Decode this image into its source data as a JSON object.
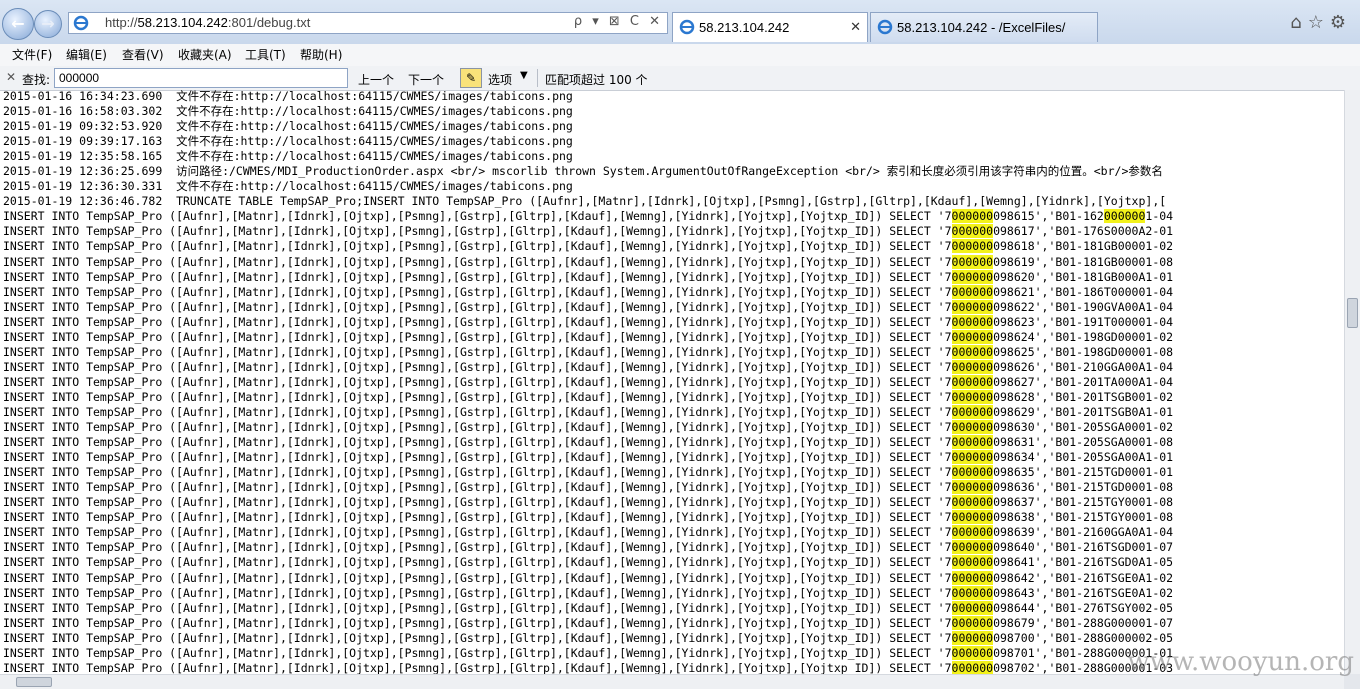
{
  "browser": {
    "address_url_prefix": "http://",
    "address_url_host": "58.213.104.242",
    "address_url_rest": ":801/debug.txt",
    "address_tools": "ρ ▾ ⊠ C ✕",
    "tabs": [
      {
        "title": "58.213.104.242"
      },
      {
        "title": "58.213.104.242 - /ExcelFiles/"
      }
    ],
    "close_label": "✕"
  },
  "menu": [
    "文件(F)",
    "编辑(E)",
    "查看(V)",
    "收藏夹(A)",
    "工具(T)",
    "帮助(H)"
  ],
  "find": {
    "label": "查找:",
    "value": "000000",
    "prev": "上一个",
    "next": "下一个",
    "options": "选项",
    "count": "匹配项超过 100 个"
  },
  "log_lines": [
    "2015-01-16 16:34:23.690  文件不存在:http://localhost:64115/CWMES/images/tabicons.png",
    "2015-01-16 16:58:03.302  文件不存在:http://localhost:64115/CWMES/images/tabicons.png",
    "2015-01-19 09:32:53.920  文件不存在:http://localhost:64115/CWMES/images/tabicons.png",
    "2015-01-19 09:39:17.163  文件不存在:http://localhost:64115/CWMES/images/tabicons.png",
    "2015-01-19 12:35:58.165  文件不存在:http://localhost:64115/CWMES/images/tabicons.png",
    "2015-01-19 12:36:25.699  访问路径:/CWMES/MDI_ProductionOrder.aspx <br/> mscorlib thrown System.ArgumentOutOfRangeException <br/> 索引和长度必须引用该字符串内的位置。<br/>参数名",
    "2015-01-19 12:36:30.331  文件不存在:http://localhost:64115/CWMES/images/tabicons.png",
    "2015-01-19 12:36:46.782  TRUNCATE TABLE TempSAP_Pro;INSERT INTO TempSAP_Pro ([Aufnr],[Matnr],[Idnrk],[Ojtxp],[Psmng],[Gstrp],[Gltrp],[Kdauf],[Wemng],[Yidnrk],[Yojtxp],[",
    "INSERT INTO TempSAP_Pro ([Aufnr],[Matnr],[Idnrk],[Ojtxp],[Psmng],[Gstrp],[Gltrp],[Kdauf],[Wemng],[Yidnrk],[Yojtxp],[Yojtxp_ID]) SELECT '7000000098615','B01-1620000001-04",
    "INSERT INTO TempSAP_Pro ([Aufnr],[Matnr],[Idnrk],[Ojtxp],[Psmng],[Gstrp],[Gltrp],[Kdauf],[Wemng],[Yidnrk],[Yojtxp],[Yojtxp_ID]) SELECT '7000000098617','B01-176S0000A2-01",
    "INSERT INTO TempSAP_Pro ([Aufnr],[Matnr],[Idnrk],[Ojtxp],[Psmng],[Gstrp],[Gltrp],[Kdauf],[Wemng],[Yidnrk],[Yojtxp],[Yojtxp_ID]) SELECT '7000000098618','B01-181GB00001-02",
    "INSERT INTO TempSAP_Pro ([Aufnr],[Matnr],[Idnrk],[Ojtxp],[Psmng],[Gstrp],[Gltrp],[Kdauf],[Wemng],[Yidnrk],[Yojtxp],[Yojtxp_ID]) SELECT '7000000098619','B01-181GB00001-08",
    "INSERT INTO TempSAP_Pro ([Aufnr],[Matnr],[Idnrk],[Ojtxp],[Psmng],[Gstrp],[Gltrp],[Kdauf],[Wemng],[Yidnrk],[Yojtxp],[Yojtxp_ID]) SELECT '7000000098620','B01-181GB000A1-01",
    "INSERT INTO TempSAP_Pro ([Aufnr],[Matnr],[Idnrk],[Ojtxp],[Psmng],[Gstrp],[Gltrp],[Kdauf],[Wemng],[Yidnrk],[Yojtxp],[Yojtxp_ID]) SELECT '7000000098621','B01-186T000001-04",
    "INSERT INTO TempSAP_Pro ([Aufnr],[Matnr],[Idnrk],[Ojtxp],[Psmng],[Gstrp],[Gltrp],[Kdauf],[Wemng],[Yidnrk],[Yojtxp],[Yojtxp_ID]) SELECT '7000000098622','B01-190GVA00A1-04",
    "INSERT INTO TempSAP_Pro ([Aufnr],[Matnr],[Idnrk],[Ojtxp],[Psmng],[Gstrp],[Gltrp],[Kdauf],[Wemng],[Yidnrk],[Yojtxp],[Yojtxp_ID]) SELECT '7000000098623','B01-191T000001-04",
    "INSERT INTO TempSAP_Pro ([Aufnr],[Matnr],[Idnrk],[Ojtxp],[Psmng],[Gstrp],[Gltrp],[Kdauf],[Wemng],[Yidnrk],[Yojtxp],[Yojtxp_ID]) SELECT '7000000098624','B01-198GD00001-02",
    "INSERT INTO TempSAP_Pro ([Aufnr],[Matnr],[Idnrk],[Ojtxp],[Psmng],[Gstrp],[Gltrp],[Kdauf],[Wemng],[Yidnrk],[Yojtxp],[Yojtxp_ID]) SELECT '7000000098625','B01-198GD00001-08",
    "INSERT INTO TempSAP_Pro ([Aufnr],[Matnr],[Idnrk],[Ojtxp],[Psmng],[Gstrp],[Gltrp],[Kdauf],[Wemng],[Yidnrk],[Yojtxp],[Yojtxp_ID]) SELECT '7000000098626','B01-210GGA00A1-04",
    "INSERT INTO TempSAP_Pro ([Aufnr],[Matnr],[Idnrk],[Ojtxp],[Psmng],[Gstrp],[Gltrp],[Kdauf],[Wemng],[Yidnrk],[Yojtxp],[Yojtxp_ID]) SELECT '7000000098627','B01-201TA000A1-04",
    "INSERT INTO TempSAP_Pro ([Aufnr],[Matnr],[Idnrk],[Ojtxp],[Psmng],[Gstrp],[Gltrp],[Kdauf],[Wemng],[Yidnrk],[Yojtxp],[Yojtxp_ID]) SELECT '7000000098628','B01-201TSGB001-02",
    "INSERT INTO TempSAP_Pro ([Aufnr],[Matnr],[Idnrk],[Ojtxp],[Psmng],[Gstrp],[Gltrp],[Kdauf],[Wemng],[Yidnrk],[Yojtxp],[Yojtxp_ID]) SELECT '7000000098629','B01-201TSGB0A1-01",
    "INSERT INTO TempSAP_Pro ([Aufnr],[Matnr],[Idnrk],[Ojtxp],[Psmng],[Gstrp],[Gltrp],[Kdauf],[Wemng],[Yidnrk],[Yojtxp],[Yojtxp_ID]) SELECT '7000000098630','B01-205SGA0001-02",
    "INSERT INTO TempSAP_Pro ([Aufnr],[Matnr],[Idnrk],[Ojtxp],[Psmng],[Gstrp],[Gltrp],[Kdauf],[Wemng],[Yidnrk],[Yojtxp],[Yojtxp_ID]) SELECT '7000000098631','B01-205SGA0001-08",
    "INSERT INTO TempSAP_Pro ([Aufnr],[Matnr],[Idnrk],[Ojtxp],[Psmng],[Gstrp],[Gltrp],[Kdauf],[Wemng],[Yidnrk],[Yojtxp],[Yojtxp_ID]) SELECT '7000000098634','B01-205SGA00A1-01",
    "INSERT INTO TempSAP_Pro ([Aufnr],[Matnr],[Idnrk],[Ojtxp],[Psmng],[Gstrp],[Gltrp],[Kdauf],[Wemng],[Yidnrk],[Yojtxp],[Yojtxp_ID]) SELECT '7000000098635','B01-215TGD0001-01",
    "INSERT INTO TempSAP_Pro ([Aufnr],[Matnr],[Idnrk],[Ojtxp],[Psmng],[Gstrp],[Gltrp],[Kdauf],[Wemng],[Yidnrk],[Yojtxp],[Yojtxp_ID]) SELECT '7000000098636','B01-215TGD0001-08",
    "INSERT INTO TempSAP_Pro ([Aufnr],[Matnr],[Idnrk],[Ojtxp],[Psmng],[Gstrp],[Gltrp],[Kdauf],[Wemng],[Yidnrk],[Yojtxp],[Yojtxp_ID]) SELECT '7000000098637','B01-215TGY0001-08",
    "INSERT INTO TempSAP_Pro ([Aufnr],[Matnr],[Idnrk],[Ojtxp],[Psmng],[Gstrp],[Gltrp],[Kdauf],[Wemng],[Yidnrk],[Yojtxp],[Yojtxp_ID]) SELECT '7000000098638','B01-215TGY0001-08",
    "INSERT INTO TempSAP_Pro ([Aufnr],[Matnr],[Idnrk],[Ojtxp],[Psmng],[Gstrp],[Gltrp],[Kdauf],[Wemng],[Yidnrk],[Yojtxp],[Yojtxp_ID]) SELECT '7000000098639','B01-2160GGA0A1-04",
    "INSERT INTO TempSAP_Pro ([Aufnr],[Matnr],[Idnrk],[Ojtxp],[Psmng],[Gstrp],[Gltrp],[Kdauf],[Wemng],[Yidnrk],[Yojtxp],[Yojtxp_ID]) SELECT '7000000098640','B01-216TSGD001-07",
    "INSERT INTO TempSAP_Pro ([Aufnr],[Matnr],[Idnrk],[Ojtxp],[Psmng],[Gstrp],[Gltrp],[Kdauf],[Wemng],[Yidnrk],[Yojtxp],[Yojtxp_ID]) SELECT '7000000098641','B01-216TSGD0A1-05",
    "INSERT INTO TempSAP_Pro ([Aufnr],[Matnr],[Idnrk],[Ojtxp],[Psmng],[Gstrp],[Gltrp],[Kdauf],[Wemng],[Yidnrk],[Yojtxp],[Yojtxp_ID]) SELECT '7000000098642','B01-216TSGE0A1-02",
    "INSERT INTO TempSAP_Pro ([Aufnr],[Matnr],[Idnrk],[Ojtxp],[Psmng],[Gstrp],[Gltrp],[Kdauf],[Wemng],[Yidnrk],[Yojtxp],[Yojtxp_ID]) SELECT '7000000098643','B01-216TSGE0A1-02",
    "INSERT INTO TempSAP_Pro ([Aufnr],[Matnr],[Idnrk],[Ojtxp],[Psmng],[Gstrp],[Gltrp],[Kdauf],[Wemng],[Yidnrk],[Yojtxp],[Yojtxp_ID]) SELECT '7000000098644','B01-276TSGY002-05",
    "INSERT INTO TempSAP_Pro ([Aufnr],[Matnr],[Idnrk],[Ojtxp],[Psmng],[Gstrp],[Gltrp],[Kdauf],[Wemng],[Yidnrk],[Yojtxp],[Yojtxp_ID]) SELECT '7000000098679','B01-288G000001-07",
    "INSERT INTO TempSAP_Pro ([Aufnr],[Matnr],[Idnrk],[Ojtxp],[Psmng],[Gstrp],[Gltrp],[Kdauf],[Wemng],[Yidnrk],[Yojtxp],[Yojtxp_ID]) SELECT '7000000098700','B01-288G000002-05",
    "INSERT INTO TempSAP_Pro ([Aufnr],[Matnr],[Idnrk],[Ojtxp],[Psmng],[Gstrp],[Gltrp],[Kdauf],[Wemng],[Yidnrk],[Yojtxp],[Yojtxp_ID]) SELECT '7000000098701','B01-288G000001-01",
    "INSERT INTO TempSAP_Pro ([Aufnr],[Matnr],[Idnrk],[Ojtxp],[Psmng],[Gstrp],[Gltrp],[Kdauf],[Wemng],[Yidnrk],[Yojtxp],[Yojtxp_ID]) SELECT '7000000098702','B01-288G000001-03"
  ],
  "highlight_term": "000000",
  "highlight_color": "#f3f21b",
  "watermark": "www.wooyun.org",
  "icons": {
    "back": "back-arrow-icon",
    "forward": "forward-arrow-icon",
    "home": "home-icon",
    "favorites": "star-icon",
    "settings": "gear-icon"
  }
}
